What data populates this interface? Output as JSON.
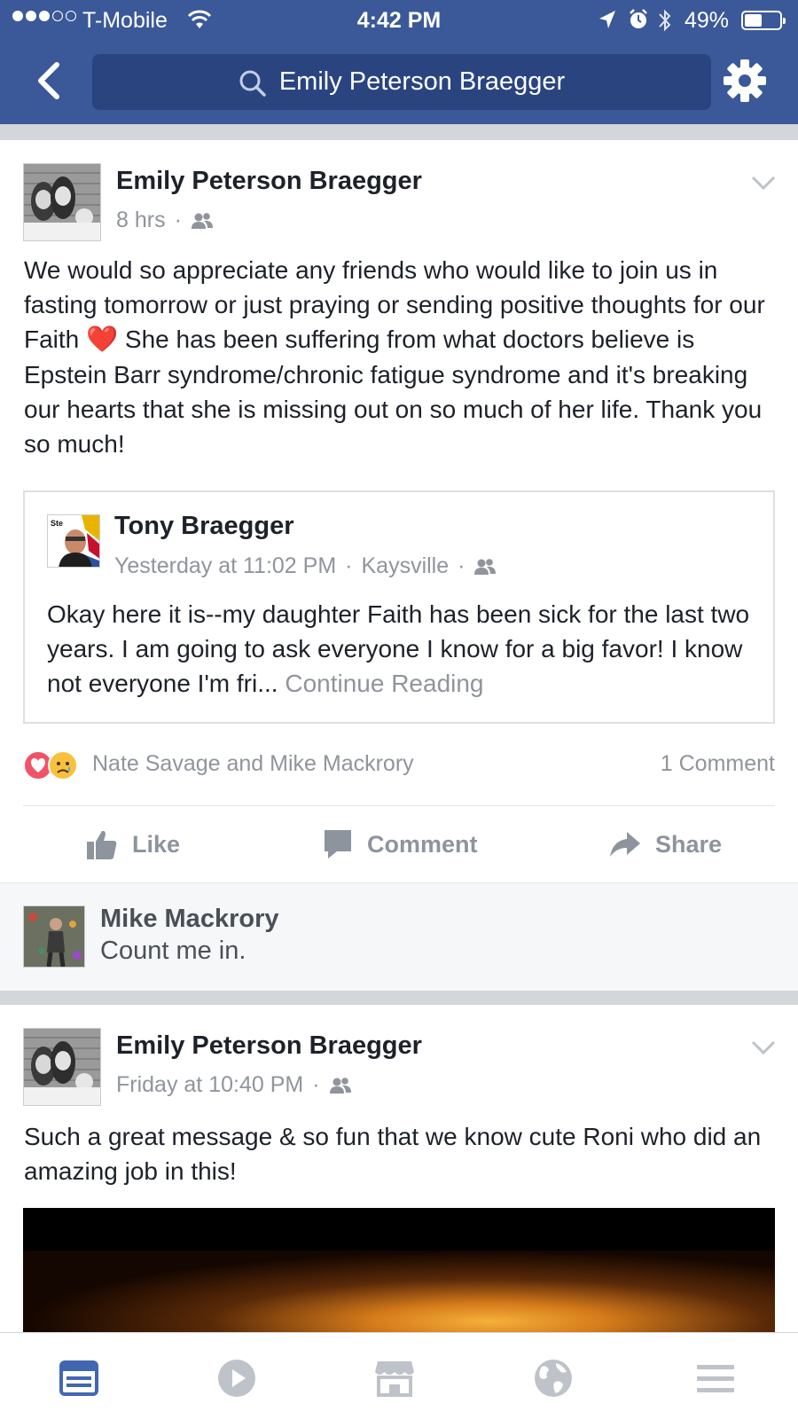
{
  "status_bar": {
    "carrier": "T-Mobile",
    "time": "4:42 PM",
    "battery_percent": "49%",
    "battery_level": 0.49,
    "signal_dots_filled": 3,
    "signal_dots_total": 5
  },
  "header": {
    "search_text": "Emily Peterson Braegger",
    "icons": {
      "back": "back-chevron-icon",
      "search": "search-icon",
      "settings": "gear-icon"
    },
    "color": "#3b5998"
  },
  "posts": [
    {
      "author": "Emily Peterson Braegger",
      "timestamp": "8 hrs",
      "dot": "·",
      "audience_icon": "friends-icon",
      "text_1": "We would so appreciate any friends who would like to join us in fasting tomorrow or just praying or sending positive thoughts for our Faith",
      "emoji": "❤️",
      "text_2": " She has been suffering from what doctors believe is Epstein Barr syndrome/chronic fatigue syndrome and it's breaking our hearts that she is missing out on so much of her life. Thank you so much!",
      "shared_post": {
        "author": "Tony Braegger",
        "timestamp": "Yesterday at 11:02 PM",
        "location": "Kaysville",
        "dot": "·",
        "text": "Okay here it is--my daughter Faith has been sick for the last two years. I am going to ask everyone I know for a big favor! I know not everyone I'm fri... ",
        "continue_label": "Continue Reading"
      },
      "reactions": {
        "icons": [
          "love-reaction-icon",
          "sad-reaction-icon"
        ],
        "names": "Nate Savage and Mike Mackrory",
        "comment_count": "1 Comment"
      },
      "actions": {
        "like": "Like",
        "comment": "Comment",
        "share": "Share"
      },
      "top_comment": {
        "author": "Mike Mackrory",
        "text": "Count me in."
      }
    },
    {
      "author": "Emily Peterson Braegger",
      "timestamp": "Friday at 10:40 PM",
      "dot": "·",
      "audience_icon": "friends-icon",
      "text": "Such a great message & so fun that we know cute Roni who did an amazing job in this!"
    }
  ],
  "tab_bar": {
    "tabs": [
      "news-feed-icon",
      "video-icon",
      "marketplace-icon",
      "notifications-globe-icon",
      "menu-icon"
    ],
    "active_color": "#4267b2",
    "inactive_color": "#bec2c9"
  }
}
